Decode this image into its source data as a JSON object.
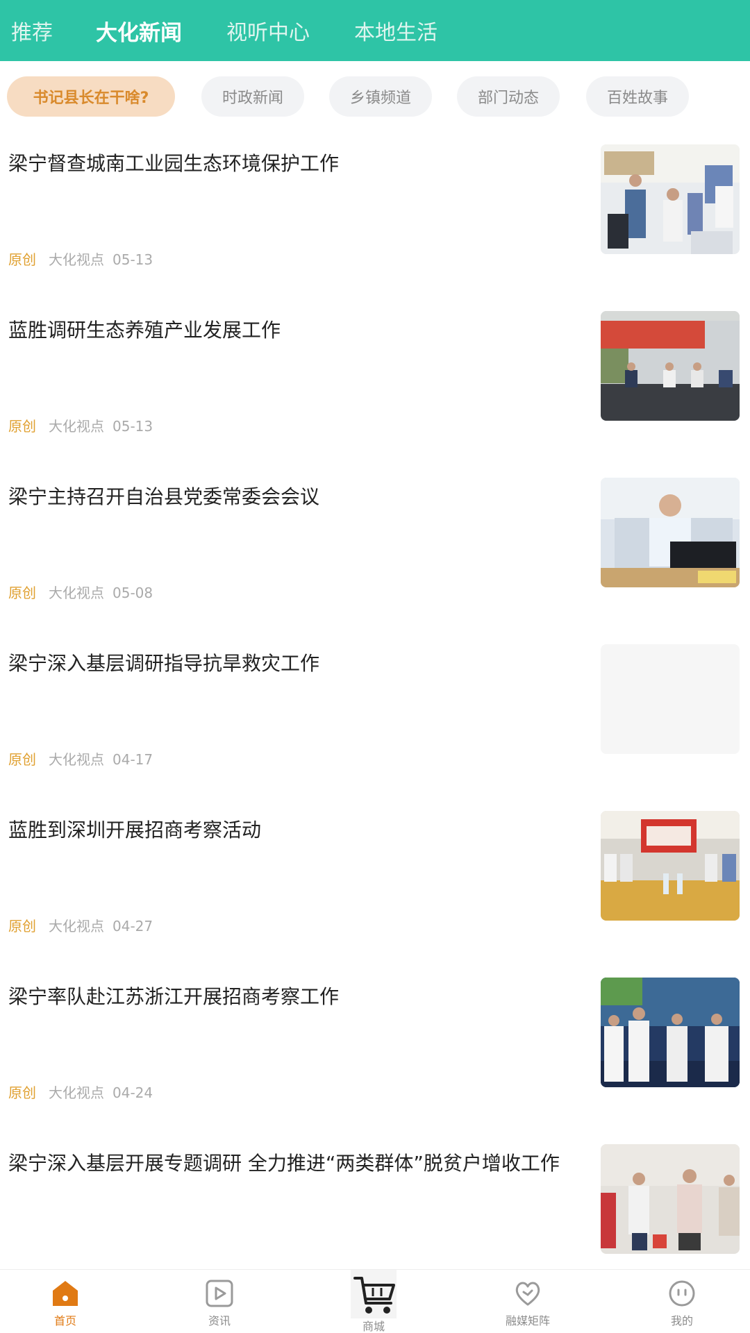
{
  "top_tabs": [
    {
      "label": "推荐"
    },
    {
      "label": "大化新闻"
    },
    {
      "label": "视听中心"
    },
    {
      "label": "本地生活"
    }
  ],
  "chips": [
    {
      "label": "书记县长在干啥?"
    },
    {
      "label": "时政新闻"
    },
    {
      "label": "乡镇频道"
    },
    {
      "label": "部门动态"
    },
    {
      "label": "百姓故事"
    }
  ],
  "news": [
    {
      "title": "梁宁督查城南工业园生态环境保护工作",
      "tag": "原创",
      "source": "大化视点",
      "date": "05-13"
    },
    {
      "title": "蓝胜调研生态养殖产业发展工作",
      "tag": "原创",
      "source": "大化视点",
      "date": "05-13"
    },
    {
      "title": "梁宁主持召开自治县党委常委会会议",
      "tag": "原创",
      "source": "大化视点",
      "date": "05-08"
    },
    {
      "title": "梁宁深入基层调研指导抗旱救灾工作",
      "tag": "原创",
      "source": "大化视点",
      "date": "04-17"
    },
    {
      "title": "蓝胜到深圳开展招商考察活动",
      "tag": "原创",
      "source": "大化视点",
      "date": "04-27"
    },
    {
      "title": "梁宁率队赴江苏浙江开展招商考察工作",
      "tag": "原创",
      "source": "大化视点",
      "date": "04-24"
    },
    {
      "title": "梁宁深入基层开展专题调研 全力推进“两类群体”脱贫户增收工作",
      "tag": "",
      "source": "",
      "date": ""
    }
  ],
  "bottom_nav": [
    {
      "label": "首页",
      "icon": "home-icon"
    },
    {
      "label": "资讯",
      "icon": "play-icon"
    },
    {
      "label": "商城",
      "icon": "cart-icon"
    },
    {
      "label": "融媒矩阵",
      "icon": "heart-icon"
    },
    {
      "label": "我的",
      "icon": "face-icon"
    }
  ],
  "colors": {
    "header": "#2ec4a6",
    "chip_active_bg": "#f7dcc2",
    "chip_active_text": "#d98a2c",
    "tag": "#e0a030",
    "nav_active": "#e07a14"
  }
}
